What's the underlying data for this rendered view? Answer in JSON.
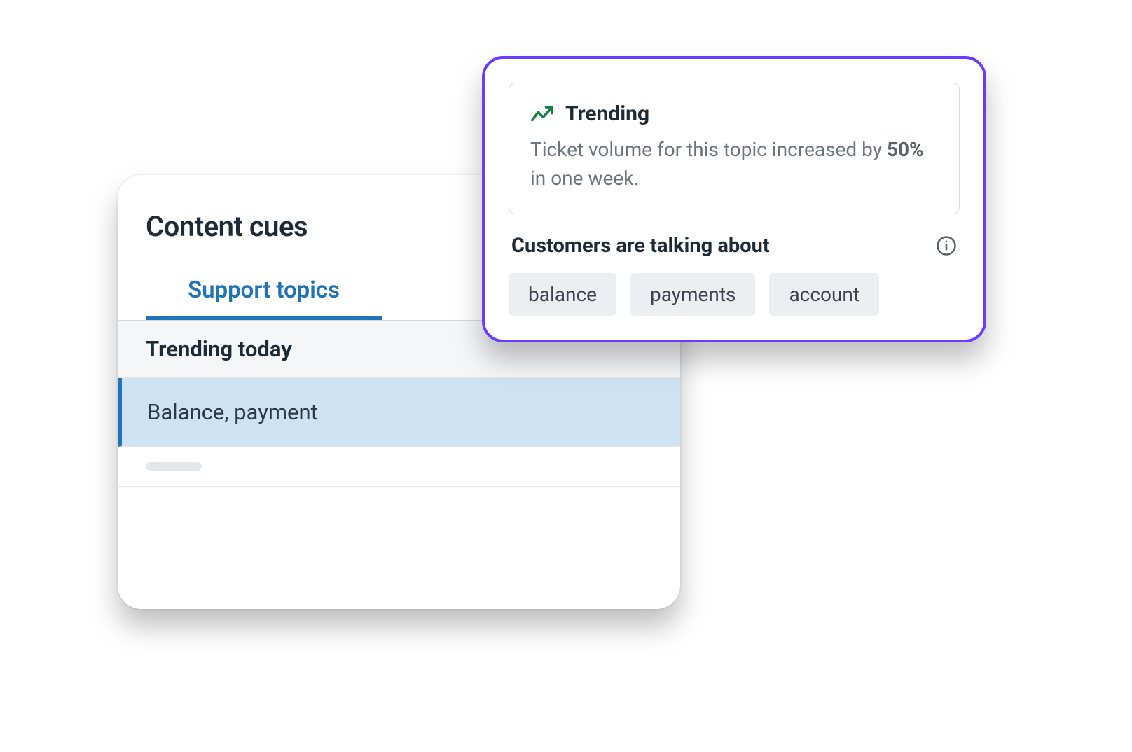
{
  "back_panel": {
    "title": "Content cues",
    "tab_label": "Support topics",
    "section_header": "Trending today",
    "selected_topic": "Balance, payment"
  },
  "front_panel": {
    "trending": {
      "label": "Trending",
      "desc_prefix": "Ticket volume for this topic increased by ",
      "desc_value": "50%",
      "desc_suffix": " in one week."
    },
    "talking_about_label": "Customers are talking about",
    "chips": [
      "balance",
      "payments",
      "account"
    ]
  }
}
